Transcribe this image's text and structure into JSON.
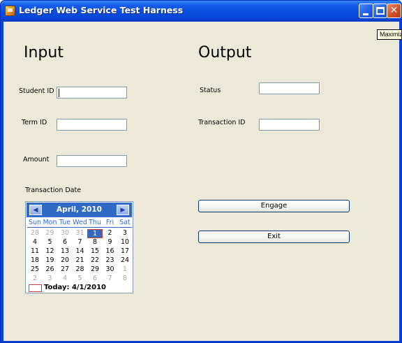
{
  "window": {
    "title": "Ledger Web Service Test Harness",
    "tooltip": "Maximize"
  },
  "input": {
    "heading": "Input",
    "student_id_label": "Student ID",
    "student_id_value": "",
    "term_id_label": "Term ID",
    "term_id_value": "",
    "amount_label": "Amount",
    "amount_value": "",
    "transaction_date_label": "Transaction Date"
  },
  "output": {
    "heading": "Output",
    "status_label": "Status",
    "status_value": "",
    "transaction_id_label": "Transaction ID",
    "transaction_id_value": ""
  },
  "buttons": {
    "engage": "Engage",
    "exit": "Exit"
  },
  "calendar": {
    "month_label": "April, 2010",
    "prev_glyph": "◀",
    "next_glyph": "▶",
    "days_of_week": [
      "Sun",
      "Mon",
      "Tue",
      "Wed",
      "Thu",
      "Fri",
      "Sat"
    ],
    "weeks": [
      [
        {
          "d": "28",
          "dim": true
        },
        {
          "d": "29",
          "dim": true
        },
        {
          "d": "30",
          "dim": true
        },
        {
          "d": "31",
          "dim": true
        },
        {
          "d": "1",
          "sel": true
        },
        {
          "d": "2"
        },
        {
          "d": "3"
        }
      ],
      [
        {
          "d": "4"
        },
        {
          "d": "5"
        },
        {
          "d": "6"
        },
        {
          "d": "7"
        },
        {
          "d": "8"
        },
        {
          "d": "9"
        },
        {
          "d": "10"
        }
      ],
      [
        {
          "d": "11"
        },
        {
          "d": "12"
        },
        {
          "d": "13"
        },
        {
          "d": "14"
        },
        {
          "d": "15"
        },
        {
          "d": "16"
        },
        {
          "d": "17"
        }
      ],
      [
        {
          "d": "18"
        },
        {
          "d": "19"
        },
        {
          "d": "20"
        },
        {
          "d": "21"
        },
        {
          "d": "22"
        },
        {
          "d": "23"
        },
        {
          "d": "24"
        }
      ],
      [
        {
          "d": "25"
        },
        {
          "d": "26"
        },
        {
          "d": "27"
        },
        {
          "d": "28"
        },
        {
          "d": "29"
        },
        {
          "d": "30"
        },
        {
          "d": "1",
          "dim": true
        }
      ],
      [
        {
          "d": "2",
          "dim": true
        },
        {
          "d": "3",
          "dim": true
        },
        {
          "d": "4",
          "dim": true
        },
        {
          "d": "5",
          "dim": true
        },
        {
          "d": "6",
          "dim": true
        },
        {
          "d": "7",
          "dim": true
        },
        {
          "d": "8",
          "dim": true
        }
      ]
    ],
    "today_label": "Today: 4/1/2010"
  },
  "colors": {
    "titlebar": "#0a4fe0",
    "client_bg": "#ece9d8",
    "calendar_accent": "#3169c6",
    "today_marker": "#d04040"
  }
}
